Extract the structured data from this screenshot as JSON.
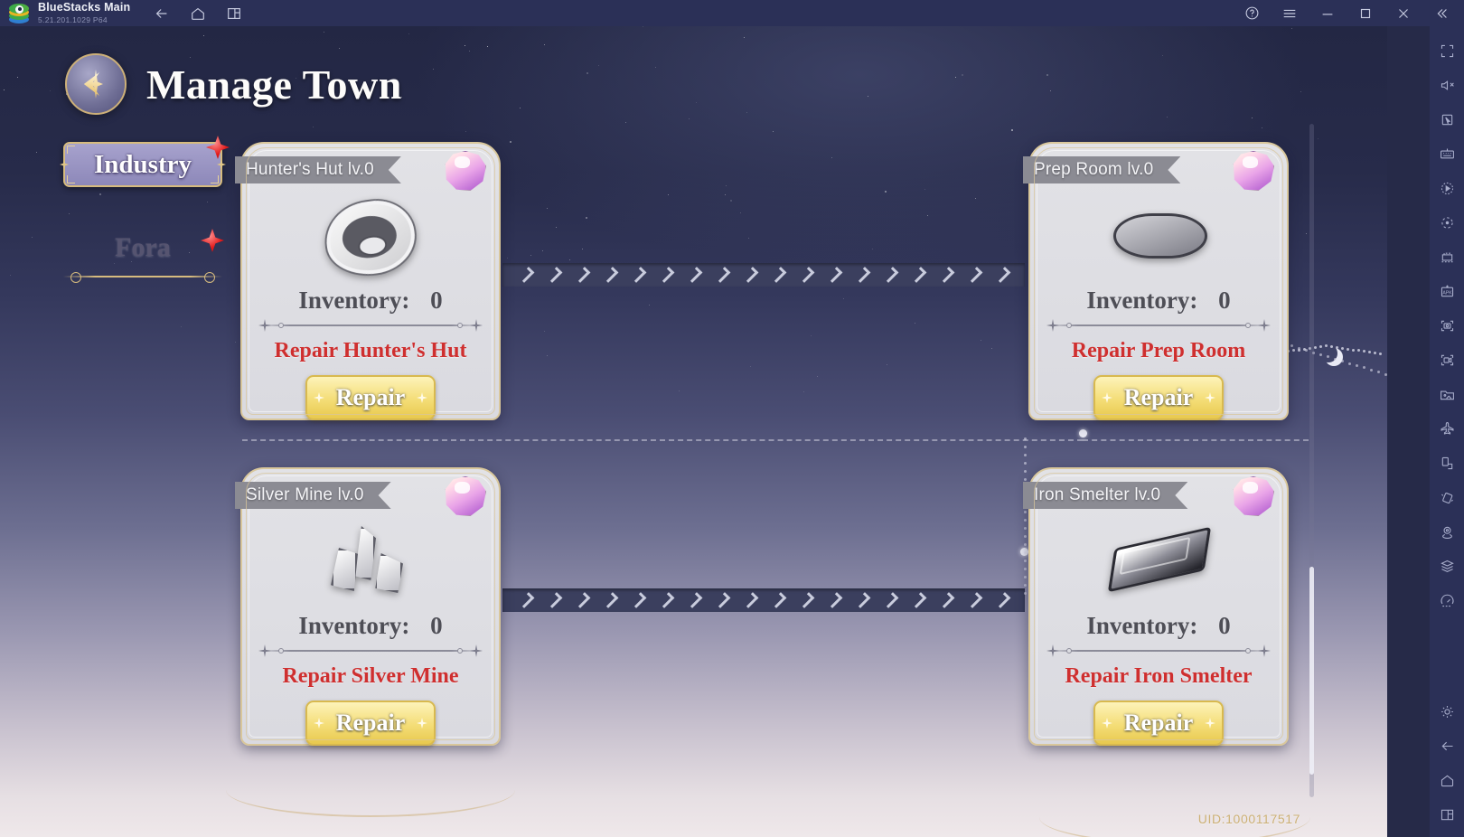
{
  "titlebar": {
    "app_name": "BlueStacks Main",
    "version": "5.21.201.1029 P64",
    "nav": [
      {
        "name": "back-icon",
        "label": "Back"
      },
      {
        "name": "home-icon",
        "label": "Home"
      },
      {
        "name": "multi-instance-icon",
        "label": "Multi-instance"
      }
    ],
    "controls": [
      {
        "name": "help-icon",
        "label": "Help"
      },
      {
        "name": "menu-icon",
        "label": "Menu"
      },
      {
        "name": "minimize-icon",
        "label": "Minimize"
      },
      {
        "name": "maximize-icon",
        "label": "Maximize"
      },
      {
        "name": "close-icon",
        "label": "Close"
      },
      {
        "name": "collapse-icon",
        "label": "Collapse"
      }
    ]
  },
  "sidebar": {
    "items": [
      {
        "name": "fullscreen-icon",
        "label": "Full screen"
      },
      {
        "name": "mute-icon",
        "label": "Mute"
      },
      {
        "name": "cursor-icon",
        "label": "Cursor control"
      },
      {
        "name": "keyboard-icon",
        "label": "Game controls"
      },
      {
        "name": "macro-icon",
        "label": "Macro recorder"
      },
      {
        "name": "sync-icon",
        "label": "Sync operations"
      },
      {
        "name": "script-icon",
        "label": "Script"
      },
      {
        "name": "apk-icon",
        "label": "Install APK"
      },
      {
        "name": "screenshot-icon",
        "label": "Screenshot"
      },
      {
        "name": "record-icon",
        "label": "Record screen"
      },
      {
        "name": "media-manager-icon",
        "label": "Media manager"
      },
      {
        "name": "airplane-icon",
        "label": "Airplane mode"
      },
      {
        "name": "rotate-icon",
        "label": "Rotate"
      },
      {
        "name": "shake-icon",
        "label": "Shake"
      },
      {
        "name": "location-icon",
        "label": "Location"
      },
      {
        "name": "layers-icon",
        "label": "Eco mode"
      },
      {
        "name": "performance-icon",
        "label": "Performance"
      }
    ],
    "bottom_items": [
      {
        "name": "settings-icon",
        "label": "Settings"
      },
      {
        "name": "android-back-icon",
        "label": "Back"
      },
      {
        "name": "android-home-icon",
        "label": "Home"
      },
      {
        "name": "android-recents-icon",
        "label": "Recents"
      }
    ]
  },
  "game": {
    "page_title": "Manage Town",
    "crest_icon": "manage-town-crest-icon",
    "tab": {
      "label": "Industry",
      "selected": true,
      "badge": "red-diamond-badge"
    },
    "section": {
      "label": "Fora",
      "badge": "red-diamond-badge"
    },
    "uid": "UID:1000117517",
    "accent_gold": "#d6bb7e",
    "repair_text_color": "#cf2f2f",
    "cards": [
      {
        "name": "Hunter's Hut",
        "level": "lv.0",
        "banner": "Hunter's Hut lv.0",
        "icon": "meat-icon",
        "inventory_label": "Inventory:",
        "inventory_value": "0",
        "repair_text": "Repair Hunter's Hut",
        "button_label": "Repair",
        "gem": "crystal-gem-icon"
      },
      {
        "name": "Prep Room",
        "level": "lv.0",
        "banner": "Prep Room lv.0",
        "icon": "sausage-icon",
        "inventory_label": "Inventory:",
        "inventory_value": "0",
        "repair_text": "Repair Prep Room",
        "button_label": "Repair",
        "gem": "crystal-gem-icon"
      },
      {
        "name": "Silver Mine",
        "level": "lv.0",
        "banner": "Silver Mine lv.0",
        "icon": "ore-crystal-icon",
        "inventory_label": "Inventory:",
        "inventory_value": "0",
        "repair_text": "Repair Silver Mine",
        "button_label": "Repair",
        "gem": "crystal-gem-icon"
      },
      {
        "name": "Iron Smelter",
        "level": "lv.0",
        "banner": "Iron Smelter lv.0",
        "icon": "ingot-icon",
        "inventory_label": "Inventory:",
        "inventory_value": "0",
        "repair_text": "Repair Iron Smelter",
        "button_label": "Repair",
        "gem": "crystal-gem-icon"
      }
    ]
  }
}
